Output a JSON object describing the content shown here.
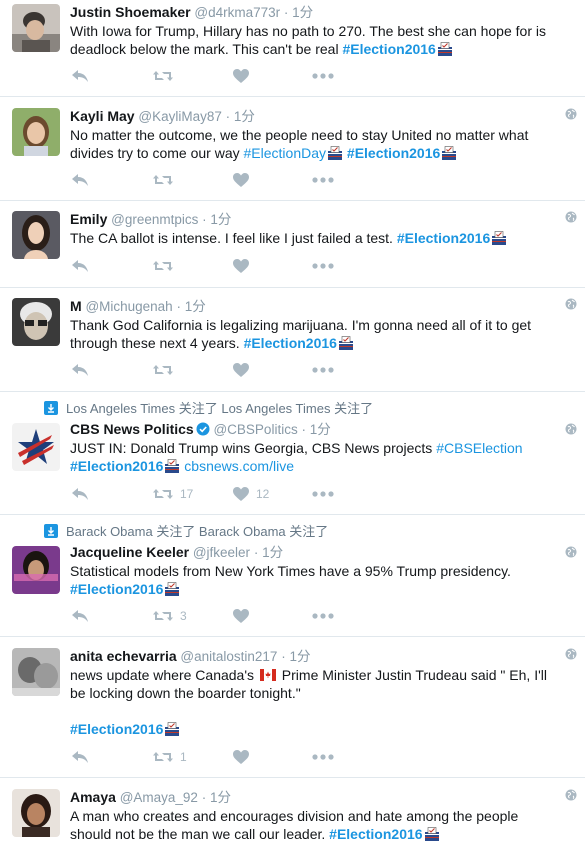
{
  "tweets": [
    {
      "name": "Justin Shoemaker",
      "handle": "@d4rkma773r",
      "time": "1分",
      "text_parts": [
        "With Iowa for Trump, Hillary has no path to 270. The best she can hope for is deadlock below the mark. This can't be real  ",
        "#Election2016"
      ],
      "retweets": "",
      "likes": ""
    },
    {
      "name": "Kayli May",
      "handle": "@KayliMay87",
      "time": "1分",
      "text_parts": [
        "No matter the outcome, we the people need to stay United no matter what divides try to come our way ",
        "#ElectionDay",
        " ",
        "#Election2016"
      ],
      "retweets": "",
      "likes": ""
    },
    {
      "name": "Emily",
      "handle": "@greenmtpics",
      "time": "1分",
      "text_parts": [
        "The CA ballot is intense. I feel like I just failed a test. ",
        "#Election2016"
      ],
      "retweets": "",
      "likes": ""
    },
    {
      "name": "M",
      "handle": "@Michugenah",
      "time": "1分",
      "text_parts": [
        "Thank God California is legalizing marijuana. I'm gonna need all of it to get through these next 4 years. ",
        "#Election2016"
      ],
      "retweets": "",
      "likes": ""
    },
    {
      "context": "Los Angeles Times 关注了 Los Angeles Times 关注了",
      "name": "CBS News Politics",
      "handle": "@CBSPolitics",
      "time": "1分",
      "text_parts": [
        "JUST IN: Donald Trump wins Georgia, CBS News projects ",
        "#CBSElection",
        "#Election2016",
        "cbsnews.com/live"
      ],
      "retweets": "17",
      "likes": "12"
    },
    {
      "context": "Barack Obama 关注了 Barack Obama 关注了",
      "name": "Jacqueline Keeler",
      "handle": "@jfkeeler",
      "time": "1分",
      "text_parts": [
        "Statistical models from New York Times have a 95% Trump presidency.",
        "#Election2016"
      ],
      "retweets": "3",
      "likes": ""
    },
    {
      "name": "anita echevarria",
      "handle": "@anitalostin217",
      "time": "1分",
      "text_parts": [
        "news update where Canada's ",
        " Prime Minister Justin Trudeau said \" Eh, I'll be locking down the boarder tonight.\"",
        "#Election2016"
      ],
      "retweets": "1",
      "likes": ""
    },
    {
      "name": "Amaya",
      "handle": "@Amaya_92",
      "time": "1分",
      "text_parts": [
        "A man who creates and encourages division and hate among the people should not be the man we call our leader. ",
        "#Election2016"
      ],
      "retweets": "",
      "likes": ""
    }
  ],
  "icons": {
    "reply": "reply-icon",
    "retweet": "retweet-icon",
    "like": "heart-icon",
    "more": "more-icon",
    "globe": "globe-icon",
    "ballot": "ballot-box-icon",
    "flag": "canada-flag-icon",
    "verified": "verified-badge-icon",
    "follow_context": "follow-context-icon"
  },
  "colors": {
    "link": "#1b95e0",
    "muted": "#8899a6",
    "action": "#aab8c2",
    "divider": "#e1e8ed"
  }
}
